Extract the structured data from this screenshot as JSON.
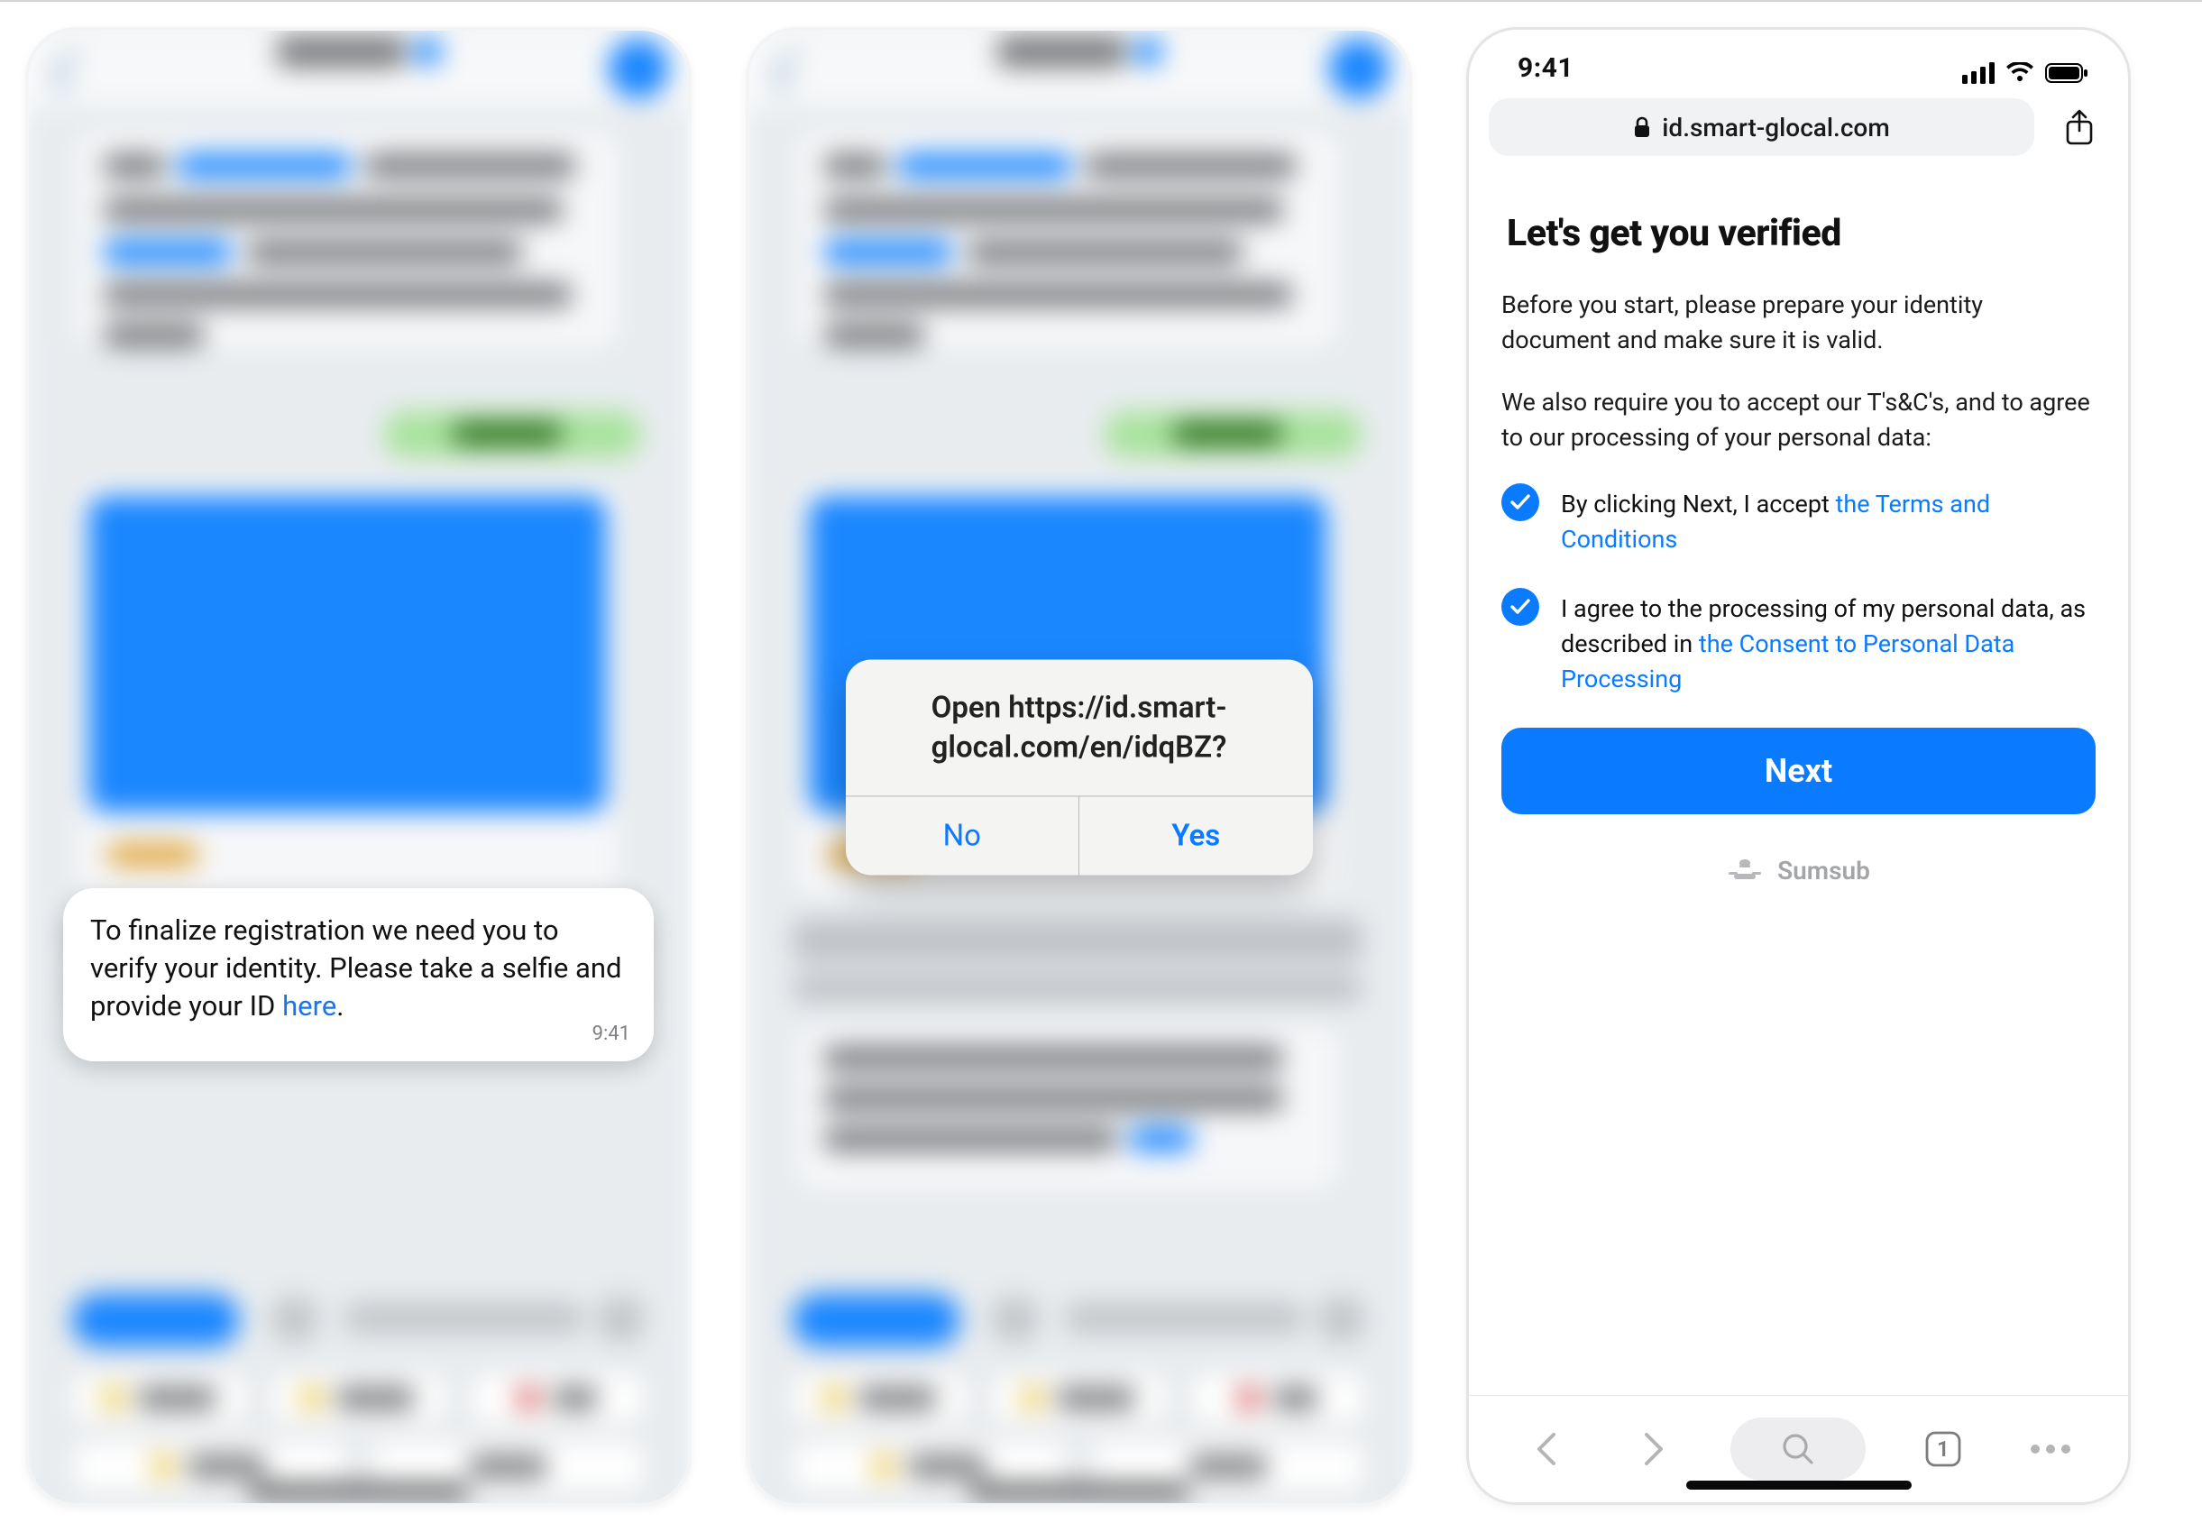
{
  "phone1": {
    "bubble_text": "To finalize registration we need you to verify your identity. Please take a selfie and provide your ID ",
    "bubble_link": "here",
    "bubble_suffix": ".",
    "bubble_time": "9:41"
  },
  "phone2": {
    "alert_title": "Open https://id.smart-glocal.com/en/idqBZ?",
    "alert_no": "No",
    "alert_yes": "Yes"
  },
  "phone3": {
    "status_time": "9:41",
    "url_host": "id.smart-glocal.com",
    "heading": "Let's get you verified",
    "para1": "Before you start, please prepare your identity document and make sure it is valid.",
    "para2": "We also require you to accept our T's&C's, and to agree to our processing of your personal data:",
    "check1_pre": "By clicking Next, I accept ",
    "check1_link": "the Terms and Conditions",
    "check2_pre": "I agree to the processing of my personal data, as described in ",
    "check2_link": "the Consent to Personal Data Processing",
    "next_label": "Next",
    "footer_brand": "Sumsub",
    "tab_count": "1"
  }
}
